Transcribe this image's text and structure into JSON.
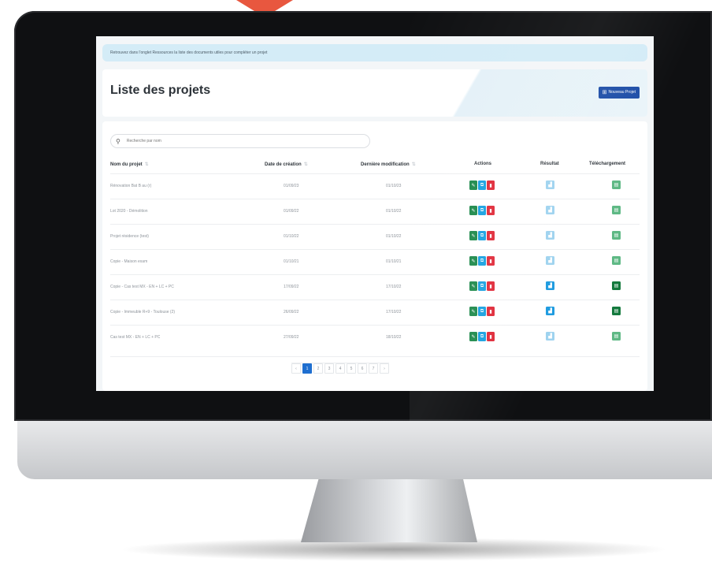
{
  "banner": {
    "text": "Retrouvez dans l'onglet Ressources la liste des documents utiles pour compléter un projet"
  },
  "header": {
    "title": "Liste des projets",
    "new_button_label": "Nouveau Projet",
    "new_button_icon": "plus-square-icon"
  },
  "search": {
    "placeholder": "Recherche par nom",
    "icon": "search-icon"
  },
  "table": {
    "columns": [
      "Nom du projet",
      "Date de création",
      "Dernière modification",
      "Actions",
      "Résultat",
      "Téléchargement"
    ],
    "rows": [
      {
        "name": "Rénovation Bat B au (r)",
        "created": "01/09/23",
        "modified": "01/10/23",
        "result_active": false,
        "download_active": false
      },
      {
        "name": "Lot 2020 - Démolition",
        "created": "01/09/22",
        "modified": "01/10/22",
        "result_active": false,
        "download_active": false
      },
      {
        "name": "Projet résidence (test)",
        "created": "01/10/22",
        "modified": "01/10/22",
        "result_active": false,
        "download_active": false
      },
      {
        "name": "Copie - Maison exam",
        "created": "01/10/21",
        "modified": "01/10/21",
        "result_active": false,
        "download_active": false
      },
      {
        "name": "Copie - Cas test MX - EN + LC + PC",
        "created": "17/09/22",
        "modified": "17/10/22",
        "result_active": true,
        "download_active": true
      },
      {
        "name": "Copie - Immeuble R+9 - Toulouse (2)",
        "created": "26/09/22",
        "modified": "17/10/22",
        "result_active": true,
        "download_active": true
      },
      {
        "name": "Cas test MX - EN + LC + PC",
        "created": "27/09/22",
        "modified": "18/10/22",
        "result_active": false,
        "download_active": false
      }
    ]
  },
  "pagination": {
    "items": [
      "‹",
      "1",
      "2",
      "3",
      "4",
      "5",
      "6",
      "7",
      "›"
    ],
    "current": "1"
  },
  "colors": {
    "primary": "#1f4fa8",
    "edit": "#1f8a4c",
    "copy": "#1aa1e0",
    "delete": "#e02b3a",
    "banner": "#d4ecf7",
    "accent_arrow": "#e8573f"
  }
}
